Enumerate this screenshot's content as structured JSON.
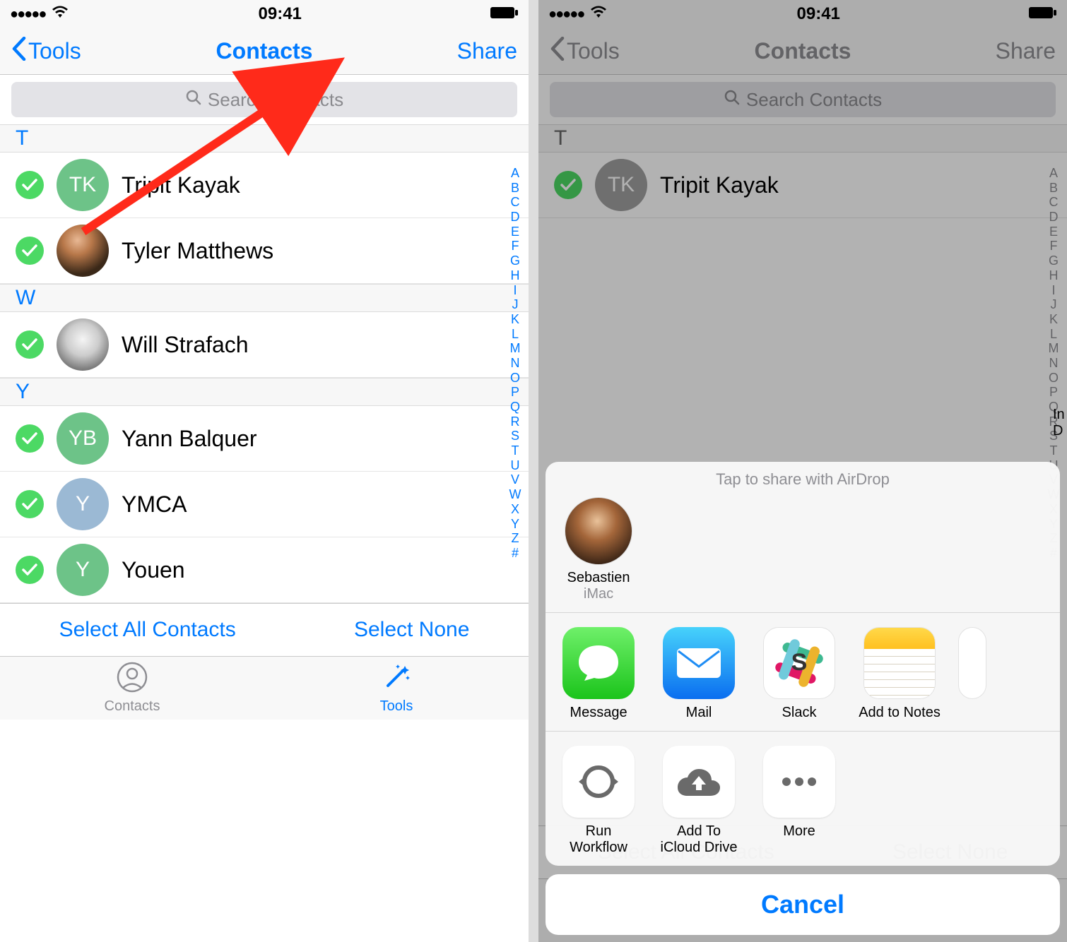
{
  "status": {
    "time": "09:41"
  },
  "nav": {
    "back": "Tools",
    "title": "Contacts",
    "share": "Share"
  },
  "search": {
    "placeholder": "Search Contacts"
  },
  "sections": {
    "t": "T",
    "w": "W",
    "y": "Y"
  },
  "contacts": {
    "tk": {
      "initials": "TK",
      "name": "Tripit Kayak"
    },
    "tm": {
      "name": "Tyler Matthews"
    },
    "ws": {
      "name": "Will Strafach"
    },
    "yb": {
      "initials": "YB",
      "name": "Yann Balquer"
    },
    "ymca": {
      "initials": "Y",
      "name": "YMCA"
    },
    "youen": {
      "initials": "Y",
      "name": "Youen"
    }
  },
  "index_letters": [
    "A",
    "B",
    "C",
    "D",
    "E",
    "F",
    "G",
    "H",
    "I",
    "J",
    "K",
    "L",
    "M",
    "N",
    "O",
    "P",
    "Q",
    "R",
    "S",
    "T",
    "U",
    "V",
    "W",
    "X",
    "Y",
    "Z",
    "#"
  ],
  "bottom": {
    "select_all": "Select All Contacts",
    "select_none": "Select None"
  },
  "tabs": {
    "contacts": "Contacts",
    "tools": "Tools"
  },
  "sheet": {
    "airdrop_hint": "Tap to share with AirDrop",
    "airdrop_target": {
      "name": "Sebastien",
      "device": "iMac"
    },
    "apps": {
      "message": "Message",
      "mail": "Mail",
      "slack": "Slack",
      "notes": "Add to Notes"
    },
    "actions": {
      "workflow": "Run\nWorkflow",
      "icloud": "Add To\niCloud Drive",
      "more": "More"
    },
    "cancel": "Cancel"
  }
}
